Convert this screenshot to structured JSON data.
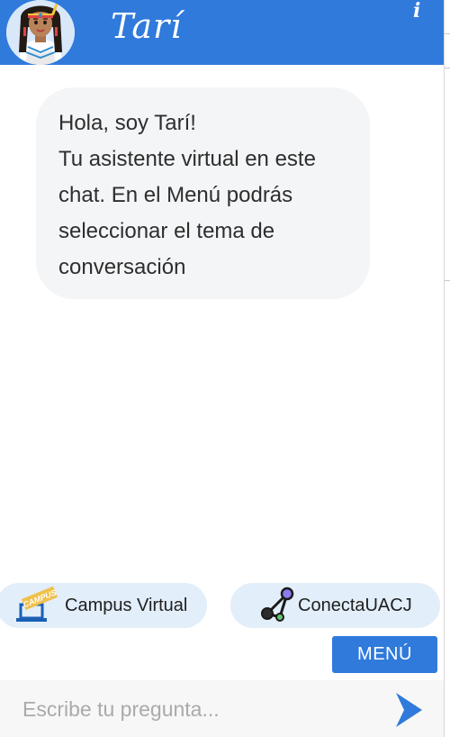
{
  "header": {
    "bot_name": "Tarí",
    "info_label": "i",
    "avatar_icon": "woman-avatar-icon",
    "background_color": "#2f7adb"
  },
  "messages": [
    {
      "sender": "bot",
      "lines": [
        "Hola, soy Tarí!",
        "Tu asistente virtual en este",
        "chat. En el Menú podrás",
        "seleccionar el tema de",
        "conversación"
      ]
    }
  ],
  "quick_replies": [
    {
      "label": "Campus Virtual",
      "icon": "laptop-campus-icon",
      "badge": "CAMPUS"
    },
    {
      "label": "ConectaUACJ",
      "icon": "network-nodes-icon"
    }
  ],
  "menu_button": {
    "label": "MENÚ"
  },
  "composer": {
    "placeholder": "Escribe tu pregunta...",
    "value": "",
    "send_icon": "send-arrow-icon"
  },
  "colors": {
    "accent": "#2f7adb",
    "bubble_background": "#f4f5f7",
    "quick_reply_background": "#e2eef9",
    "send_arrow": "#2f7adb"
  }
}
